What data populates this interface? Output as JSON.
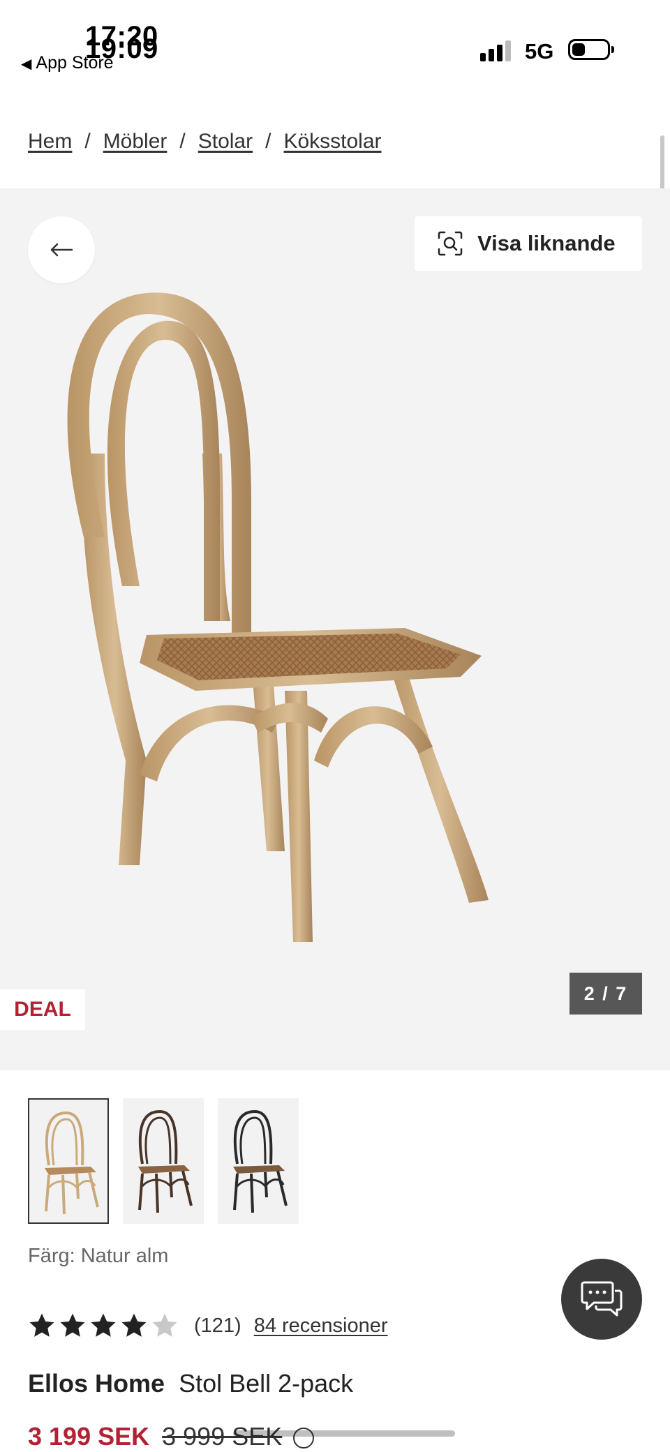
{
  "status_bar": {
    "time_primary": "17:20",
    "time_secondary": "19:09",
    "back_app_label": "App Store",
    "network": "5G"
  },
  "breadcrumb": {
    "items": [
      "Hem",
      "Möbler",
      "Stolar",
      "Köksstolar"
    ],
    "separator": "/"
  },
  "hero": {
    "similar_button_label": "Visa liknande",
    "image_counter": "2 / 7",
    "deal_badge": "DEAL"
  },
  "thumbnails": [
    {
      "color": "natural",
      "selected": true
    },
    {
      "color": "dark-brown",
      "selected": false
    },
    {
      "color": "black",
      "selected": false
    }
  ],
  "color_label": "Färg: Natur alm",
  "rating": {
    "stars": 4,
    "max_stars": 5,
    "count_text": "(121)",
    "reviews_link": "84 recensioner"
  },
  "product": {
    "brand": "Ellos Home",
    "name": "Stol Bell 2-pack"
  },
  "price": {
    "current": "3 199 SEK",
    "original": "3 999 SEK"
  },
  "colors": {
    "deal_red": "#b22234",
    "hero_bg": "#f4f3f4",
    "counter_bg": "#575757",
    "chat_bg": "#3a3a3a",
    "star_filled": "#222222",
    "star_empty": "#c8c8c8"
  },
  "icons": {
    "back": "arrow-left-icon",
    "similar": "visual-search-icon",
    "chat": "chat-bubble-icon",
    "info": "info-icon"
  }
}
